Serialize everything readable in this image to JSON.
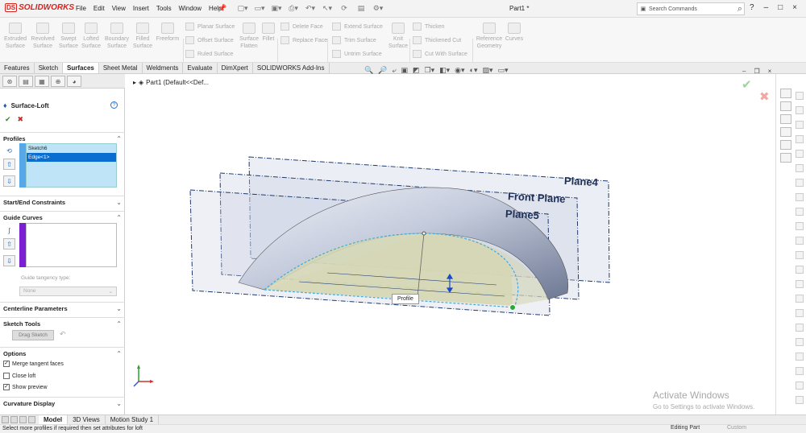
{
  "app": {
    "brand": "SOLIDWORKS",
    "document_title": "Part1 *",
    "menu": [
      "File",
      "Edit",
      "View",
      "Insert",
      "Tools",
      "Window",
      "Help"
    ],
    "search_placeholder": "Search Commands",
    "window_controls": [
      "?",
      "–",
      "□",
      "×"
    ]
  },
  "ribbon": {
    "big_buttons": [
      {
        "label": "Extruded Surface",
        "icon": "extruded-surface-icon"
      },
      {
        "label": "Revolved Surface",
        "icon": "revolved-surface-icon"
      },
      {
        "label": "Swept Surface",
        "icon": "swept-surface-icon"
      },
      {
        "label": "Lofted Surface",
        "icon": "lofted-surface-icon"
      },
      {
        "label": "Boundary Surface",
        "icon": "boundary-surface-icon"
      },
      {
        "label": "Filled Surface",
        "icon": "filled-surface-icon"
      },
      {
        "label": "Freeform",
        "icon": "freeform-icon"
      },
      {
        "label": "Surface Flatten",
        "icon": "surface-flatten-icon"
      },
      {
        "label": "Fillet",
        "icon": "fillet-icon"
      },
      {
        "label": "Knit Surface",
        "icon": "knit-surface-icon"
      },
      {
        "label": "Reference Geometry",
        "icon": "reference-geometry-icon"
      },
      {
        "label": "Curves",
        "icon": "curves-icon"
      }
    ],
    "small_buttons": [
      "Planar Surface",
      "Offset Surface",
      "Ruled Surface",
      "Delete Face",
      "Replace Face",
      "Extend Surface",
      "Trim Surface",
      "Untrim Surface",
      "Thicken",
      "Thickened Cut",
      "Cut With Surface"
    ]
  },
  "command_tabs": [
    "Features",
    "Sketch",
    "Surfaces",
    "Sheet Metal",
    "Weldments",
    "Evaluate",
    "DimXpert",
    "SOLIDWORKS Add-Ins"
  ],
  "active_tab": "Surfaces",
  "property_manager": {
    "feature_name": "Surface-Loft",
    "sections": {
      "profiles": "Profiles",
      "start_end": "Start/End Constraints",
      "guide_curves": "Guide Curves",
      "centerline": "Centerline Parameters",
      "sketch_tools": "Sketch Tools",
      "options": "Options",
      "curvature": "Curvature Display"
    },
    "profiles_list": [
      "Sketch6",
      "Edge<1>"
    ],
    "selected_profile": "Edge<1>",
    "guide_tangency_label": "Guide tangency type:",
    "guide_tangency_value": "None",
    "drag_sketch_label": "Drag Sketch",
    "options": [
      {
        "label": "Merge tangent faces",
        "checked": true
      },
      {
        "label": "Close loft",
        "checked": false
      },
      {
        "label": "Show preview",
        "checked": true
      }
    ]
  },
  "viewport": {
    "tree_item": "Part1  (Default<<Def...",
    "planes": [
      "Plane4",
      "Front Plane",
      "Plane5"
    ],
    "callout": "Profile",
    "colors": {
      "surface": "#b9c2d8",
      "fill": "#d6d7b4",
      "plane_border": "#1e3a6e",
      "edge": "#3fa9e0",
      "point": "#22aa33"
    }
  },
  "bottom_tabs": [
    "Model",
    "3D Views",
    "Motion Study 1"
  ],
  "active_bottom_tab": "Model",
  "status": {
    "message": "Select more profiles if required then set attributes for loft",
    "editing": "Editing Part",
    "units": "Custom"
  },
  "watermark": {
    "title": "Activate Windows",
    "subtitle": "Go to Settings to activate Windows."
  }
}
